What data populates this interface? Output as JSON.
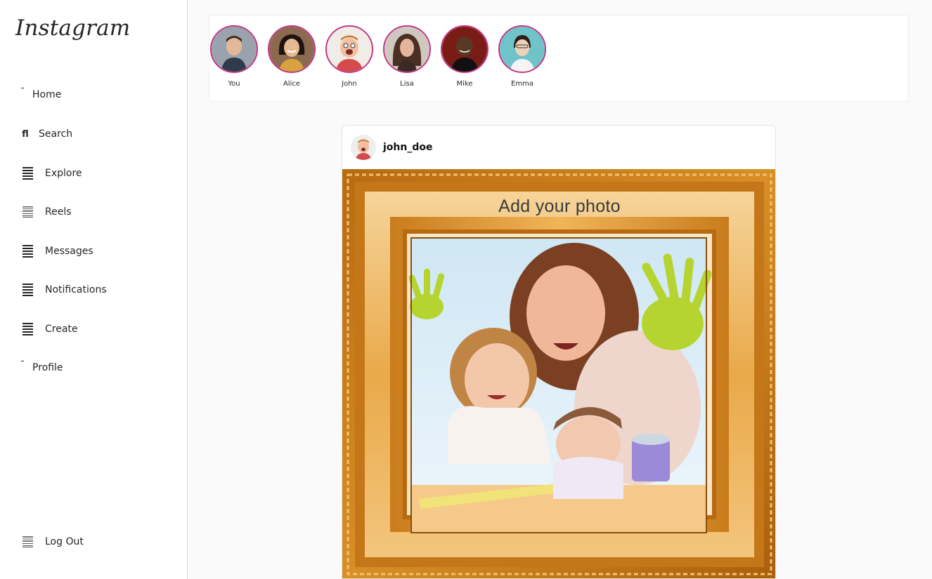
{
  "sidebar": {
    "logo": "Instagram",
    "items": [
      {
        "label": "Home",
        "icon": "home-icon"
      },
      {
        "label": "Search",
        "icon": "search-icon"
      },
      {
        "label": "Explore",
        "icon": "explore-icon"
      },
      {
        "label": "Reels",
        "icon": "reels-icon"
      },
      {
        "label": "Messages",
        "icon": "messages-icon"
      },
      {
        "label": "Notifications",
        "icon": "notifications-icon"
      },
      {
        "label": "Create",
        "icon": "create-icon"
      },
      {
        "label": "Profile",
        "icon": "profile-icon"
      }
    ],
    "logout": {
      "label": "Log Out",
      "icon": "logout-icon"
    },
    "search_glyph": "fl"
  },
  "stories": [
    {
      "name": "You"
    },
    {
      "name": "Alice"
    },
    {
      "name": "John"
    },
    {
      "name": "Lisa"
    },
    {
      "name": "Mike"
    },
    {
      "name": "Emma"
    }
  ],
  "post": {
    "username": "john_doe",
    "frame_caption": "Add your photo"
  },
  "colors": {
    "story_ring": "#c13584",
    "frame_gold": "#d8901e",
    "background": "#fafafa"
  }
}
